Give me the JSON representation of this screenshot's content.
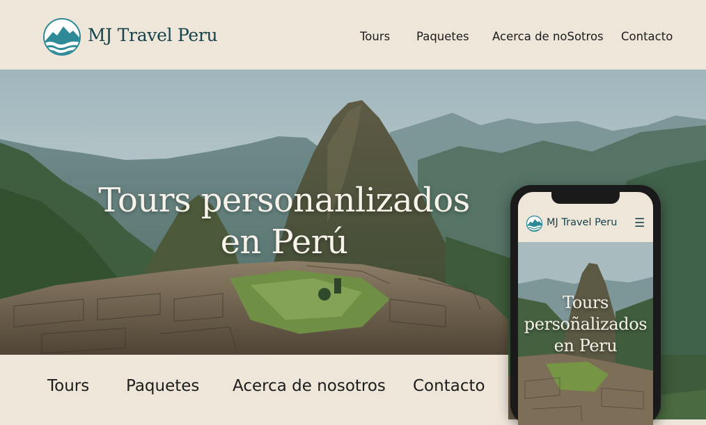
{
  "header": {
    "brand": "MJ Travel Peru",
    "logo_icon": "mountain-wave-logo-icon",
    "nav": [
      {
        "label": "Tours"
      },
      {
        "label": "Paquetes"
      },
      {
        "label": "Acerca de noSotros"
      },
      {
        "label": "Contacto"
      }
    ]
  },
  "hero": {
    "title_line1": "Tours personanlizados",
    "title_line2": "en Perú"
  },
  "bottom_nav": [
    {
      "label": "Tours"
    },
    {
      "label": "Paquetes"
    },
    {
      "label": "Acerca de nosotros"
    },
    {
      "label": "Contacto"
    }
  ],
  "phone": {
    "brand": "MJ Travel Peru",
    "menu_icon": "hamburger-menu-icon",
    "menu_glyph": "☰",
    "title_line1": "Tours",
    "title_line2": "persoñalizados",
    "title_line3": "en Peru"
  },
  "colors": {
    "background": "#efe6da",
    "brand_teal": "#15424b",
    "logo_teal": "#2e8a96",
    "hero_text": "#f7f3ea"
  }
}
